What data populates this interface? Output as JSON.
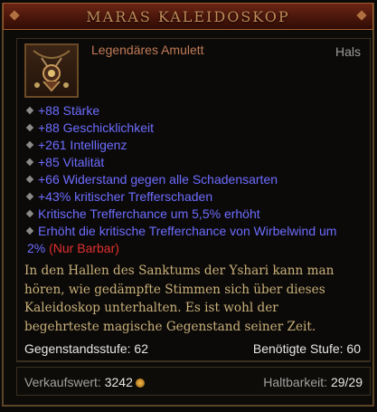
{
  "tooltip": {
    "title": "MARAS KALEIDOSKOP",
    "item_type": "Legendäres Amulett",
    "slot": "Hals",
    "affixes": [
      "+88 Stärke",
      "+88 Geschicklichkeit",
      "+261 Intelligenz",
      "+85 Vitalität",
      "+66 Widerstand gegen alle Schadensarten",
      "+43% kritischer Trefferschaden",
      "Kritische Trefferchance um 5,5% erhöht"
    ],
    "affix_last": "Erhöht die kritische Trefferchance von Wirbelwind um 2%",
    "affix_last_note": "(Nur Barbar)",
    "flavor": "In den Hallen des Sanktums der Yshari kann man hören, wie gedämpfte Stimmen sich über dieses Kaleidoskop unterhalten. Es ist wohl der begehrteste magische Gegenstand seiner Zeit.",
    "item_level_label": "Gegenstandsstufe:",
    "item_level": "62",
    "required_level_label": "Benötigte Stufe:",
    "required_level": "60",
    "sell_label": "Verkaufswert:",
    "sell_value": "3242",
    "durability_label": "Haltbarkeit:",
    "durability": "29/29",
    "icon": "amulet-icon"
  },
  "colors": {
    "affix": "#6c6cff",
    "flavor": "#c8b07a",
    "legendary": "#c07a58",
    "class_restriction": "#e03030"
  }
}
